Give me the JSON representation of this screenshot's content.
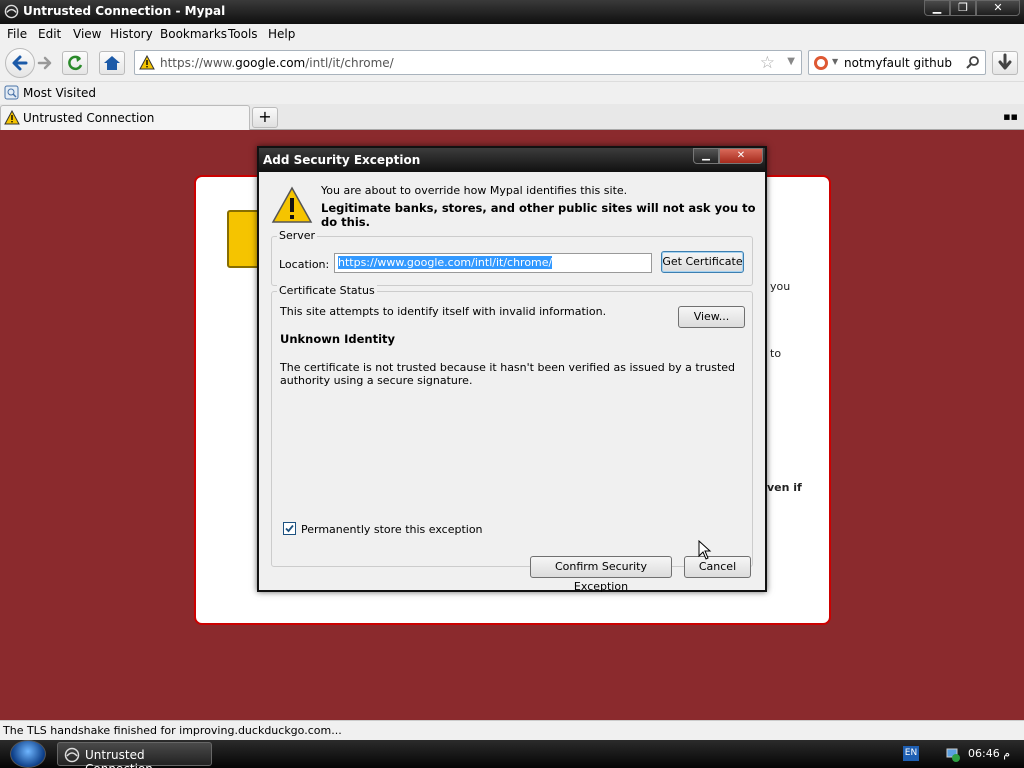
{
  "window": {
    "title": "Untrusted Connection - Mypal"
  },
  "menu": [
    "File",
    "Edit",
    "View",
    "History",
    "Bookmarks",
    "Tools",
    "Help"
  ],
  "navbar": {
    "url_prefix": "https://www.",
    "url_domain": "google.com",
    "url_path": "/intl/it/chrome/",
    "search_text": "notmyfault github"
  },
  "bookmarks": {
    "most_visited": "Most Visited"
  },
  "tabs": [
    {
      "label": "Untrusted Connection",
      "icon": "warning-icon",
      "active": true
    }
  ],
  "background_page": {
    "fragments": [
      "you",
      "to",
      "ven if"
    ]
  },
  "dialog": {
    "title": "Add Security Exception",
    "intro_line1": "You are about to override how Mypal identifies this site.",
    "intro_line2": "Legitimate banks, stores, and other public sites will not ask you to do this.",
    "server_group": "Server",
    "location_label": "Location:",
    "location_value": "https://www.google.com/intl/it/chrome/",
    "get_certificate": "Get Certificate",
    "status_group": "Certificate Status",
    "status_text": "This site attempts to identify itself with invalid information.",
    "view_button": "View...",
    "identity_heading": "Unknown Identity",
    "identity_desc": "The certificate is not trusted because it hasn't been verified as issued by a trusted authority using a secure signature.",
    "permanent_label": "Permanently store this exception",
    "permanent_checked": true,
    "confirm_button": "Confirm Security Exception",
    "cancel_button": "Cancel"
  },
  "status_bar": {
    "text": "The TLS handshake finished for improving.duckduckgo.com..."
  },
  "taskbar": {
    "task_label": "Untrusted Connection ...",
    "lang": "EN",
    "clock": "06:46  م"
  },
  "colors": {
    "error_bg": "#8b2a2d",
    "accent_blue": "#3399ff",
    "warning_yellow": "#f5c400"
  }
}
